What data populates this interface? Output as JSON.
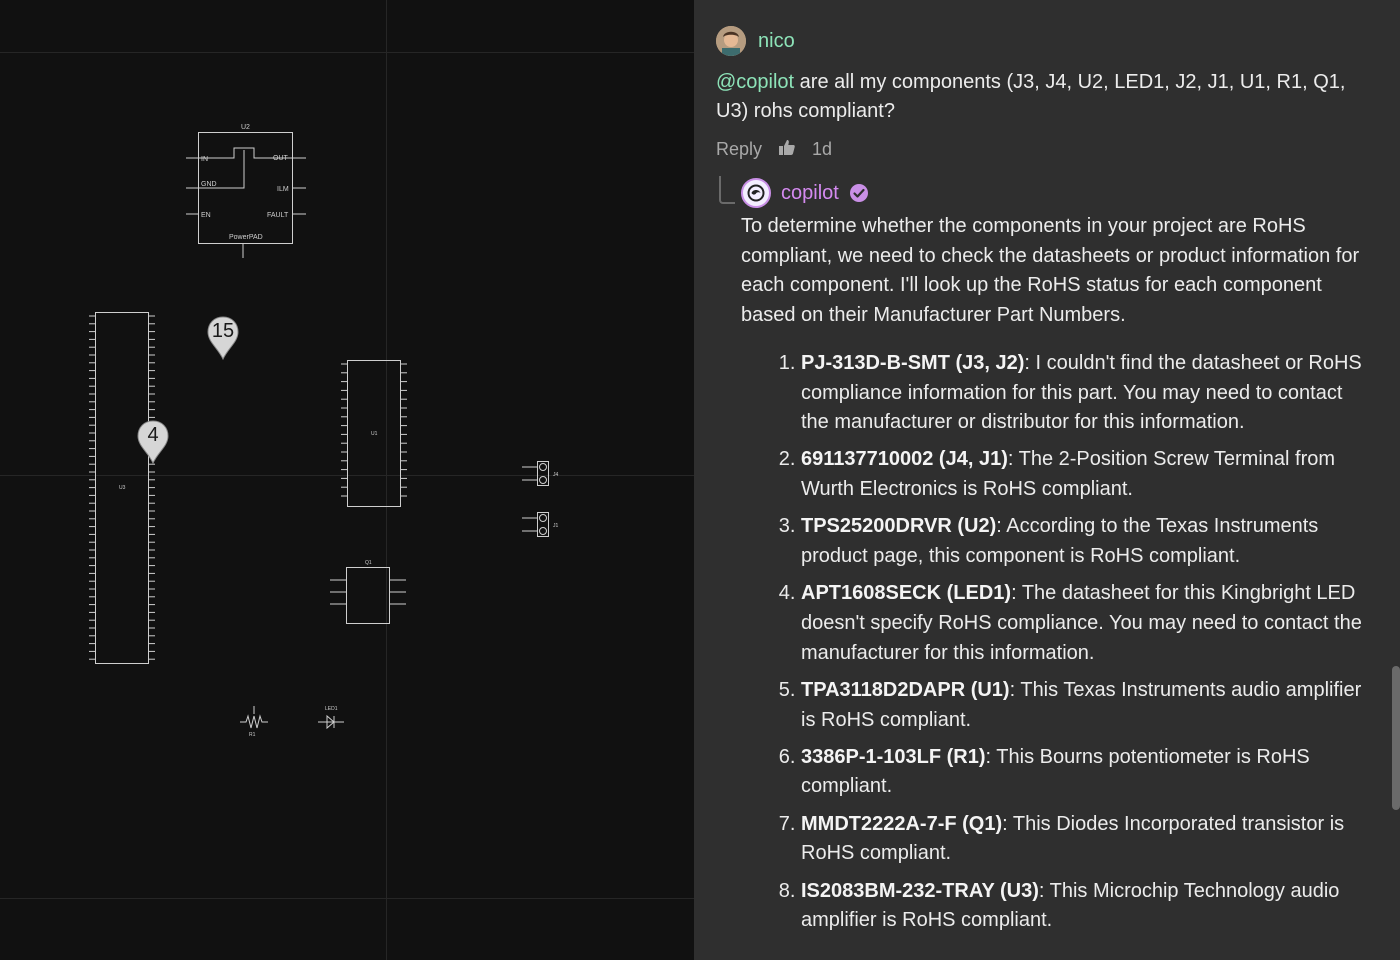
{
  "canvas": {
    "markers": [
      {
        "label": "15"
      },
      {
        "label": "4"
      }
    ],
    "schematic_labels": {
      "u2_title": "U2",
      "u2_in": "IN",
      "u2_gnd": "GND",
      "u2_en": "EN",
      "u2_out": "OUT",
      "u2_ilm": "ILM",
      "u2_fault": "FAULT",
      "u2_pad": "PowerPAD",
      "u3_title": "U3",
      "u1_title": "U1",
      "q1_title": "Q1",
      "j4_title": "J4",
      "j1_title": "J1",
      "r1_title": "R1",
      "led1_title": "LED1"
    }
  },
  "thread": {
    "user": {
      "name": "nico"
    },
    "question": {
      "mention": "@copilot",
      "text": " are all my components (J3, J4, U2, LED1, J2, J1, U1, R1, Q1, U3) rohs compliant?"
    },
    "actions": {
      "reply": "Reply",
      "age": "1d"
    },
    "bot": {
      "name": "copilot",
      "intro": "To determine whether the components in your project are RoHS compliant, we need to check the datasheets or product information for each component. I'll look up the RoHS status for each component based on their Manufacturer Part Numbers.",
      "items": [
        {
          "part": "PJ-313D-B-SMT (J3, J2)",
          "text": ": I couldn't find the datasheet or RoHS compliance information for this part. You may need to contact the manufacturer or distributor for this information."
        },
        {
          "part": "691137710002 (J4, J1)",
          "text": ": The 2-Position Screw Terminal from Wurth Electronics is RoHS compliant."
        },
        {
          "part": "TPS25200DRVR (U2)",
          "text": ": According to the Texas Instruments product page, this component is RoHS compliant."
        },
        {
          "part": "APT1608SECK (LED1)",
          "text": ": The datasheet for this Kingbright LED doesn't specify RoHS compliance. You may need to contact the manufacturer for this information."
        },
        {
          "part": "TPA3118D2DAPR (U1)",
          "text": ": This Texas Instruments audio amplifier is RoHS compliant."
        },
        {
          "part": "3386P-1-103LF (R1)",
          "text": ": This Bourns potentiometer is RoHS compliant."
        },
        {
          "part": "MMDT2222A-7-F (Q1)",
          "text": ": This Diodes Incorporated transistor is RoHS compliant."
        },
        {
          "part": "IS2083BM-232-TRAY (U3)",
          "text": ": This Microchip Technology audio amplifier is RoHS compliant."
        }
      ]
    }
  },
  "colors": {
    "canvas_bg": "#111111",
    "panel_bg": "#2f2f2f",
    "user_accent": "#8de3b8",
    "bot_accent": "#d48af0",
    "verified_badge": "#c98fe6"
  }
}
